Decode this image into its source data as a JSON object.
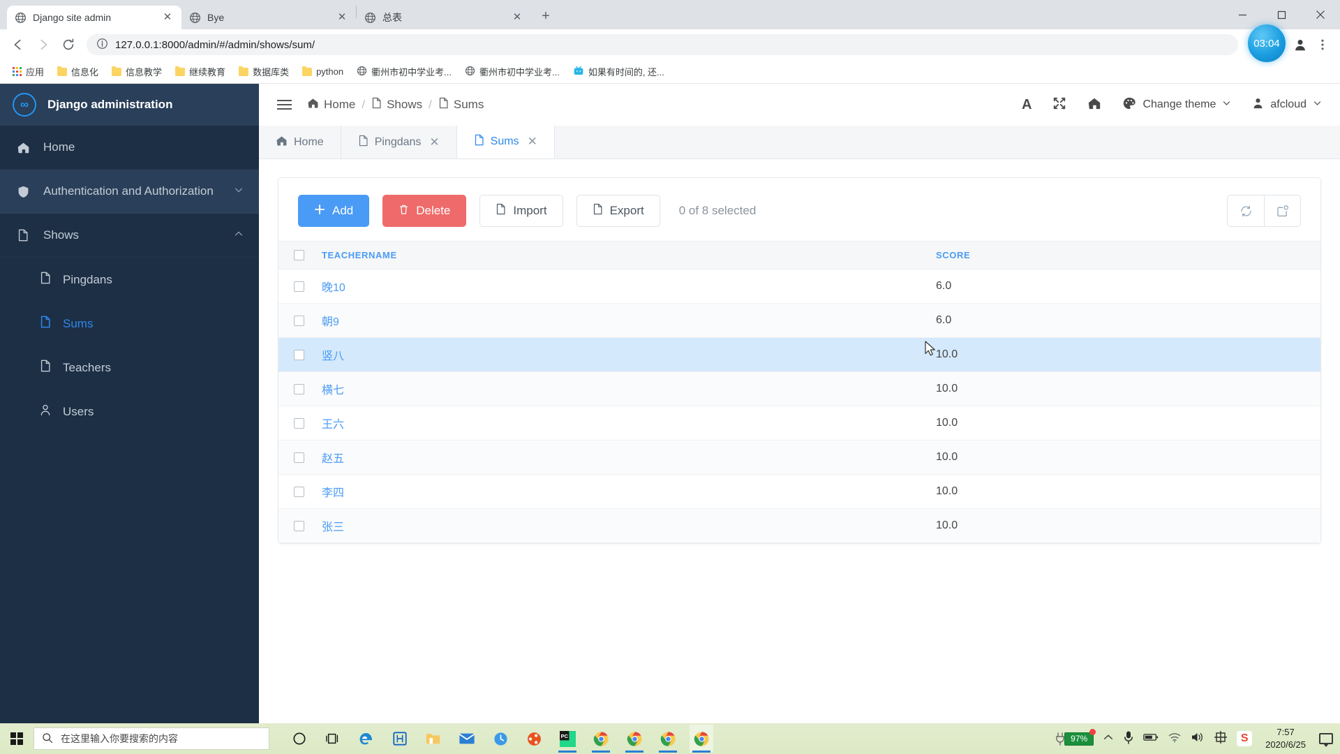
{
  "browser": {
    "tabs": [
      {
        "title": "Django site admin",
        "icon": "globe-icon",
        "active": true,
        "closable": true
      },
      {
        "title": "Bye",
        "icon": "globe-icon",
        "active": false,
        "closable": true
      },
      {
        "title": "总表",
        "icon": "globe-icon",
        "active": false,
        "closable": true
      }
    ],
    "new_tab_label": "+",
    "window_controls": {
      "minimize": "—",
      "maximize": "❐",
      "close": "✕"
    },
    "url": "127.0.0.1:8000/admin/#/admin/shows/sum/",
    "site_info_icon": "info-circle-icon",
    "nav": {
      "back": "back-icon",
      "forward": "forward-icon",
      "reload": "reload-icon"
    },
    "toolbar_icons": [
      "translate-icon",
      "extension-icon",
      "profile-icon",
      "menu-icon"
    ],
    "time_badge": "03:04",
    "bookmarks": [
      {
        "label": "应用",
        "icon": "apps-grid-icon"
      },
      {
        "label": "信息化",
        "icon": "folder-icon"
      },
      {
        "label": "信息教学",
        "icon": "folder-icon"
      },
      {
        "label": "继续教育",
        "icon": "folder-icon"
      },
      {
        "label": "数据库类",
        "icon": "folder-icon"
      },
      {
        "label": "python",
        "icon": "folder-icon"
      },
      {
        "label": "衢州市初中学业考...",
        "icon": "globe-icon"
      },
      {
        "label": "衢州市初中学业考...",
        "icon": "globe-icon"
      },
      {
        "label": "如果有时间的, 还...",
        "icon": "bilibili-icon"
      }
    ]
  },
  "sidebar": {
    "brand": {
      "logo": "infinity-icon",
      "title": "Django administration"
    },
    "items": [
      {
        "label": "Home",
        "icon": "home-icon",
        "level": "top",
        "highlight": false
      },
      {
        "label": "Authentication and Authorization",
        "icon": "shield-icon",
        "level": "top",
        "highlight": true,
        "chevron": "chevron-down-icon"
      },
      {
        "label": "Shows",
        "icon": "file-icon",
        "level": "top",
        "highlight": false,
        "chevron": "chevron-up-icon"
      },
      {
        "label": "Pingdans",
        "icon": "file-icon",
        "level": "sub",
        "selected": false
      },
      {
        "label": "Sums",
        "icon": "file-icon",
        "level": "sub",
        "selected": true
      },
      {
        "label": "Teachers",
        "icon": "file-icon",
        "level": "sub",
        "selected": false
      },
      {
        "label": "Users",
        "icon": "user-icon",
        "level": "sub",
        "selected": false
      }
    ]
  },
  "topbar": {
    "menu_toggle": "hamburger-icon",
    "breadcrumbs": [
      {
        "label": "Home",
        "icon": "home-icon"
      },
      {
        "label": "Shows",
        "icon": "file-icon"
      },
      {
        "label": "Sums",
        "icon": "file-icon"
      }
    ],
    "separator": "/",
    "actions": [
      {
        "name": "font-size-button",
        "label": "A",
        "icon": "letter-a-icon"
      },
      {
        "name": "fullscreen-button",
        "label": "",
        "icon": "expand-icon"
      },
      {
        "name": "home-button",
        "label": "",
        "icon": "home-icon"
      }
    ],
    "theme": {
      "label": "Change theme",
      "icon": "palette-icon",
      "chevron": "chevron-down-icon"
    },
    "user": {
      "label": "afcloud",
      "icon": "user-icon",
      "chevron": "chevron-down-icon"
    }
  },
  "page_tabs": [
    {
      "label": "Home",
      "icon": "home-icon",
      "active": false,
      "closable": false
    },
    {
      "label": "Pingdans",
      "icon": "file-icon",
      "active": false,
      "closable": true
    },
    {
      "label": "Sums",
      "icon": "file-icon",
      "active": true,
      "closable": true
    }
  ],
  "toolbar": {
    "add": {
      "label": "Add",
      "icon": "plus-icon",
      "color": "#4a9bf5"
    },
    "delete": {
      "label": "Delete",
      "icon": "trash-icon",
      "color": "#ef6a6a"
    },
    "import": {
      "label": "Import",
      "icon": "file-icon"
    },
    "export": {
      "label": "Export",
      "icon": "file-icon"
    },
    "selection_status": "0 of 8 selected",
    "refresh": {
      "icon": "refresh-icon"
    },
    "popout": {
      "icon": "popout-icon"
    }
  },
  "table": {
    "select_all": {
      "name": "select-all-checkbox",
      "checked": false
    },
    "columns": [
      {
        "key": "teachername",
        "label": "TEACHERNAME",
        "sortable": true
      },
      {
        "key": "score",
        "label": "SCORE",
        "sortable": true
      }
    ],
    "rows": [
      {
        "checked": false,
        "teachername": "晚10",
        "score": "6.0",
        "hover": false
      },
      {
        "checked": false,
        "teachername": "朝9",
        "score": "6.0",
        "hover": false
      },
      {
        "checked": false,
        "teachername": "竖八",
        "score": "10.0",
        "hover": true
      },
      {
        "checked": false,
        "teachername": "横七",
        "score": "10.0",
        "hover": false
      },
      {
        "checked": false,
        "teachername": "王六",
        "score": "10.0",
        "hover": false
      },
      {
        "checked": false,
        "teachername": "赵五",
        "score": "10.0",
        "hover": false
      },
      {
        "checked": false,
        "teachername": "李四",
        "score": "10.0",
        "hover": false
      },
      {
        "checked": false,
        "teachername": "张三",
        "score": "10.0",
        "hover": false
      }
    ]
  },
  "taskbar": {
    "start": {
      "icon": "windows-logo-icon"
    },
    "search": {
      "placeholder": "在这里输入你要搜索的内容",
      "icon": "search-icon"
    },
    "apps": [
      {
        "name": "cortana-icon",
        "running": false
      },
      {
        "name": "task-view-icon",
        "running": false
      },
      {
        "name": "edge-icon",
        "running": false
      },
      {
        "name": "app-blue-icon",
        "running": false
      },
      {
        "name": "file-explorer-icon",
        "running": false
      },
      {
        "name": "mail-icon",
        "running": false
      },
      {
        "name": "clock-app-icon",
        "running": false
      },
      {
        "name": "ubuntu-icon",
        "running": false
      },
      {
        "name": "pycharm-icon",
        "running": true
      },
      {
        "name": "chrome-icon",
        "running": true
      },
      {
        "name": "chrome-icon",
        "running": true
      },
      {
        "name": "chrome-icon",
        "running": true
      },
      {
        "name": "chrome-icon",
        "running": true,
        "active": true
      }
    ],
    "tray": {
      "battery_percent": "97%",
      "chevron": "chevron-up-icon",
      "icons": [
        "microphone-icon",
        "battery-icon",
        "wifi-icon",
        "volume-icon",
        "ime-chinese-icon",
        "sogou-icon"
      ],
      "ime_label": "中",
      "sogou_label": "S",
      "time": "7:57",
      "date": "2020/6/25",
      "notifications": "notification-icon"
    }
  }
}
